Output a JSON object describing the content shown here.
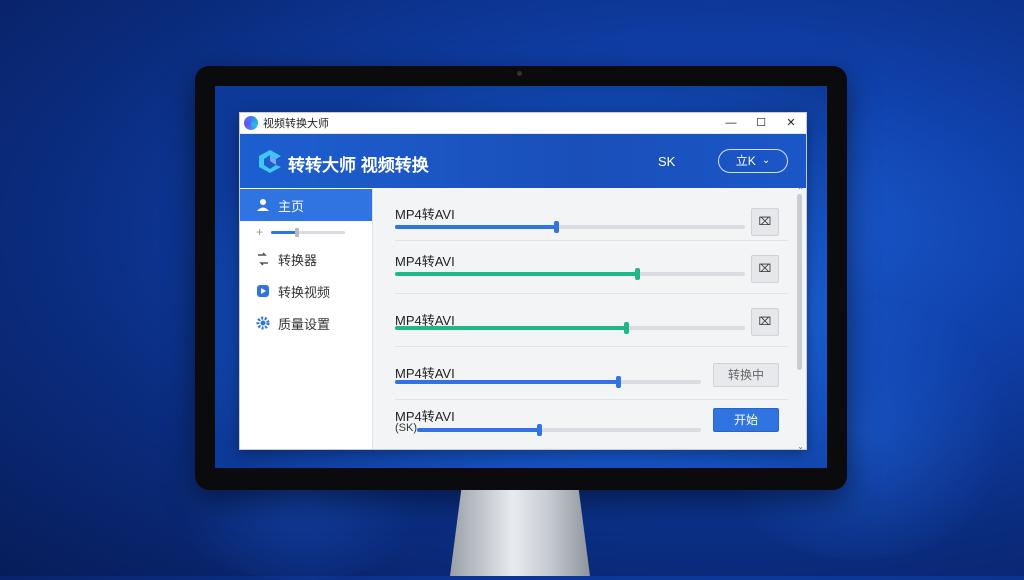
{
  "titlebar": {
    "title": "视频转换大师",
    "minimize": "—",
    "maximize": "☐",
    "close": "✕"
  },
  "header": {
    "app_name": "转转大师 视频转换",
    "sk_label": "SK",
    "dropdown_label": "立K",
    "dropdown_caret": "⌄"
  },
  "sidebar": {
    "items": [
      {
        "label": "主页",
        "icon": "user-icon",
        "active": true
      },
      {
        "label": "转换器",
        "icon": "convert-icon",
        "active": false
      },
      {
        "label": "转换视频",
        "icon": "video-icon",
        "active": false
      },
      {
        "label": "质量设置",
        "icon": "gear-icon",
        "active": false
      }
    ],
    "mini_slider_value": 0.35
  },
  "tasks": [
    {
      "label": "MP4转AVI",
      "progress": 0.46,
      "color": "#2f74e0",
      "action": "icon",
      "action_glyph": "⌧"
    },
    {
      "label": "MP4转AVI",
      "progress": 0.69,
      "color": "#20b884",
      "action": "icon",
      "action_glyph": "⌧"
    },
    {
      "label": "MP4转AVI",
      "progress": 0.66,
      "color": "#20b884",
      "action": "icon",
      "action_glyph": "⌧"
    },
    {
      "label": "MP4转AVI",
      "progress": 0.73,
      "color": "#2f74e0",
      "action": "text",
      "action_label": "转换中",
      "action_style": "gray"
    },
    {
      "label": "MP4转AVI",
      "sub_label": "(SK)",
      "progress": 0.43,
      "color": "#2f74e0",
      "action": "text",
      "action_label": "开始",
      "action_style": "blue"
    }
  ],
  "colors": {
    "accent": "#2f74e0",
    "green": "#20b884",
    "header_bg": "#1d5fd0"
  }
}
